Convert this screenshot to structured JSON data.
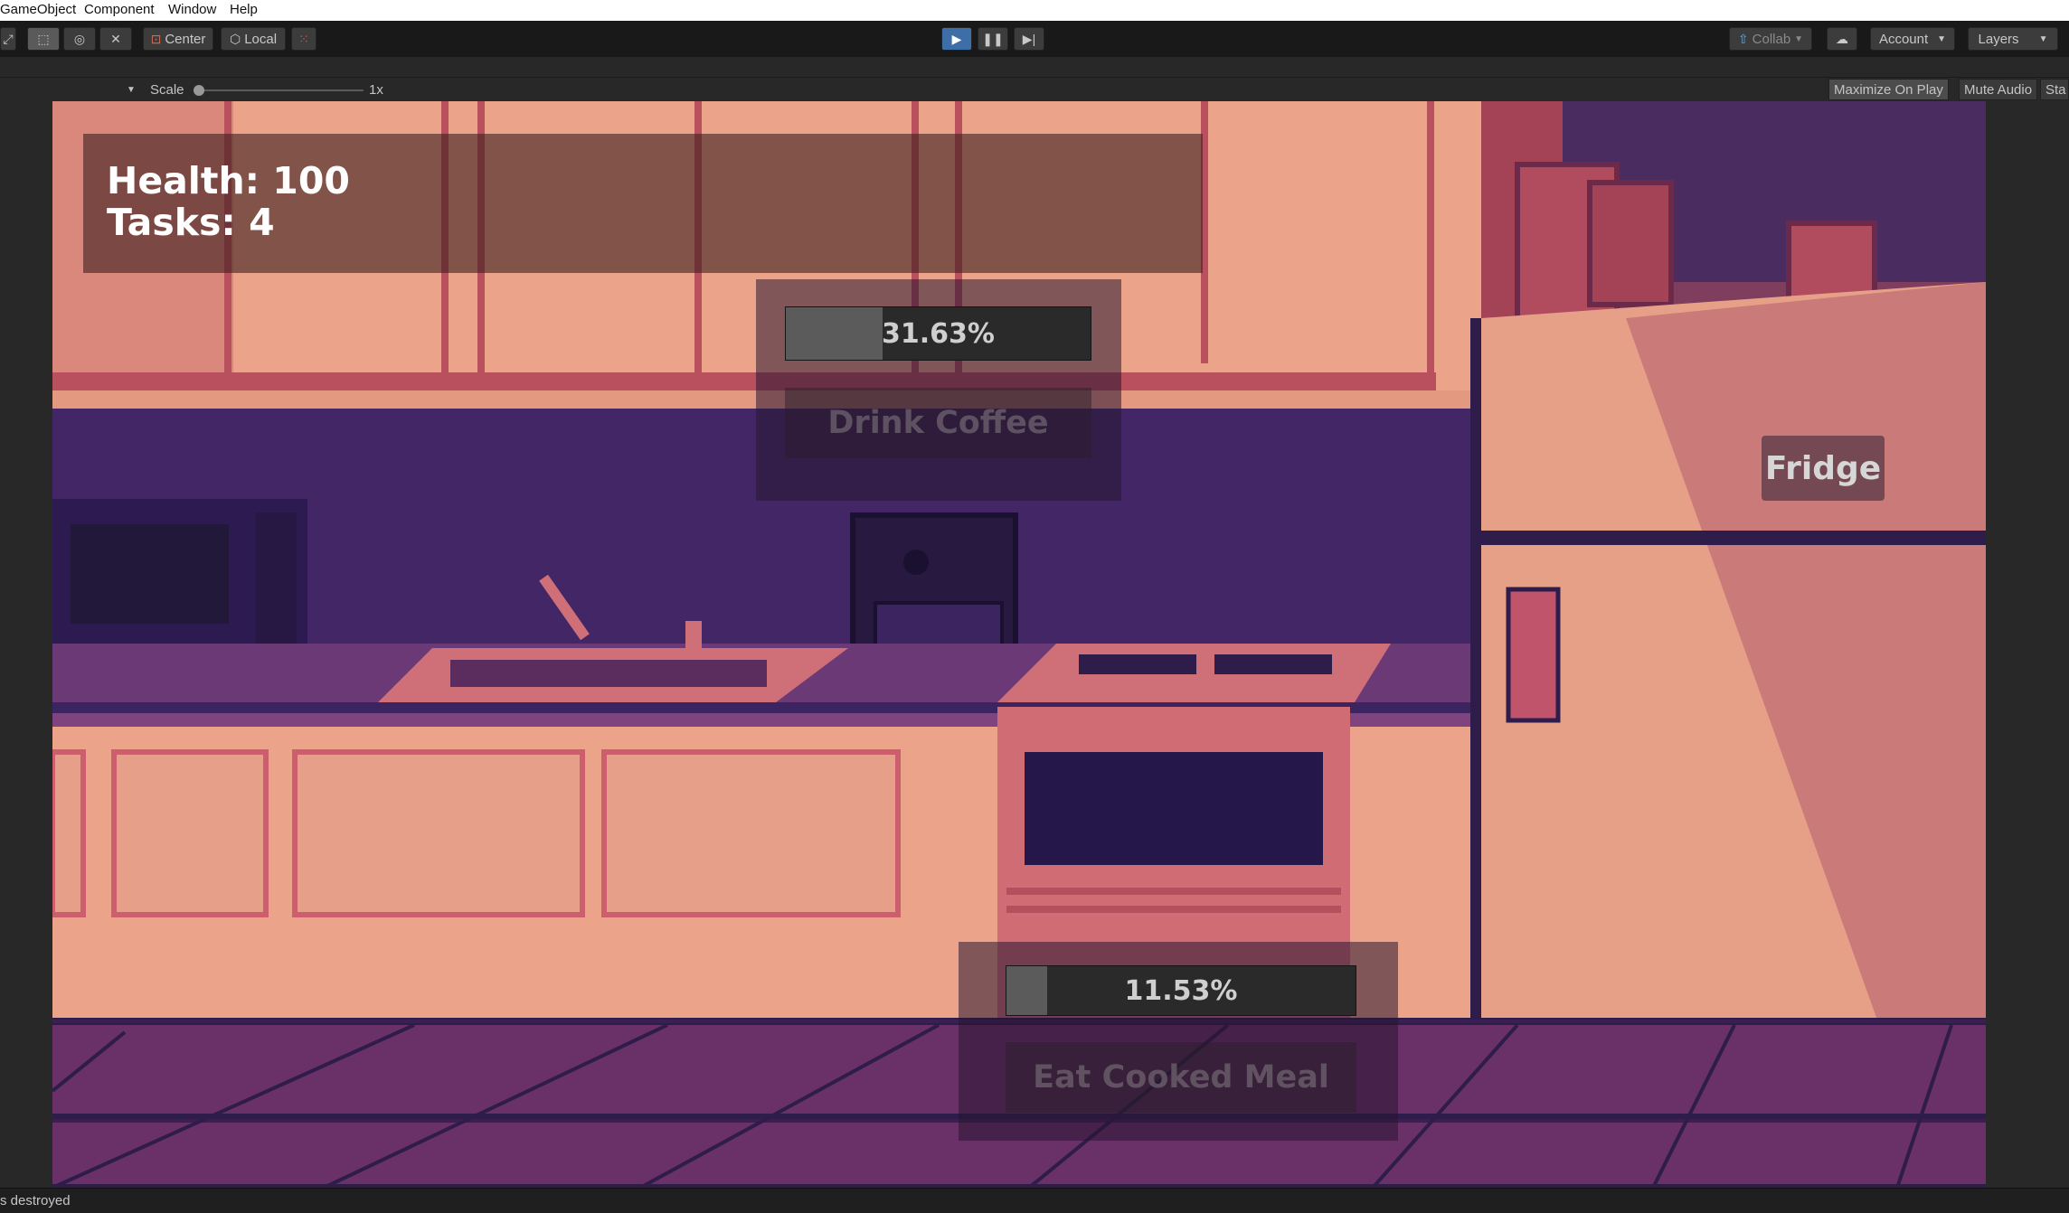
{
  "menubar": {
    "items": [
      "GameObject",
      "Component",
      "Window",
      "Help"
    ]
  },
  "toolbar": {
    "center_label": "Center",
    "local_label": "Local",
    "collab_label": "Collab",
    "account_label": "Account",
    "layers_label": "Layers"
  },
  "gamebar": {
    "scale_label": "Scale",
    "scale_value": "1x",
    "maximize_label": "Maximize On Play",
    "mute_label": "Mute Audio",
    "stats_label": "Sta"
  },
  "hud": {
    "health": "Health: 100",
    "tasks": "Tasks: 4"
  },
  "tasks": [
    {
      "progress_text": "31.63%",
      "progress": 0.3163,
      "label": "Drink Coffee"
    },
    {
      "progress_text": "11.53%",
      "progress": 0.1153,
      "label": "Eat Cooked Meal"
    }
  ],
  "fridge_label": "Fridge",
  "status": {
    "text": "s destroyed"
  },
  "colors": {
    "wall": "#eba48a",
    "backsplash": "#3c2460",
    "floor": "#5f2e62",
    "counter": "#7a3f7a",
    "hud_panel": "#3c1e1e",
    "play_active": "#3e6ea8"
  }
}
